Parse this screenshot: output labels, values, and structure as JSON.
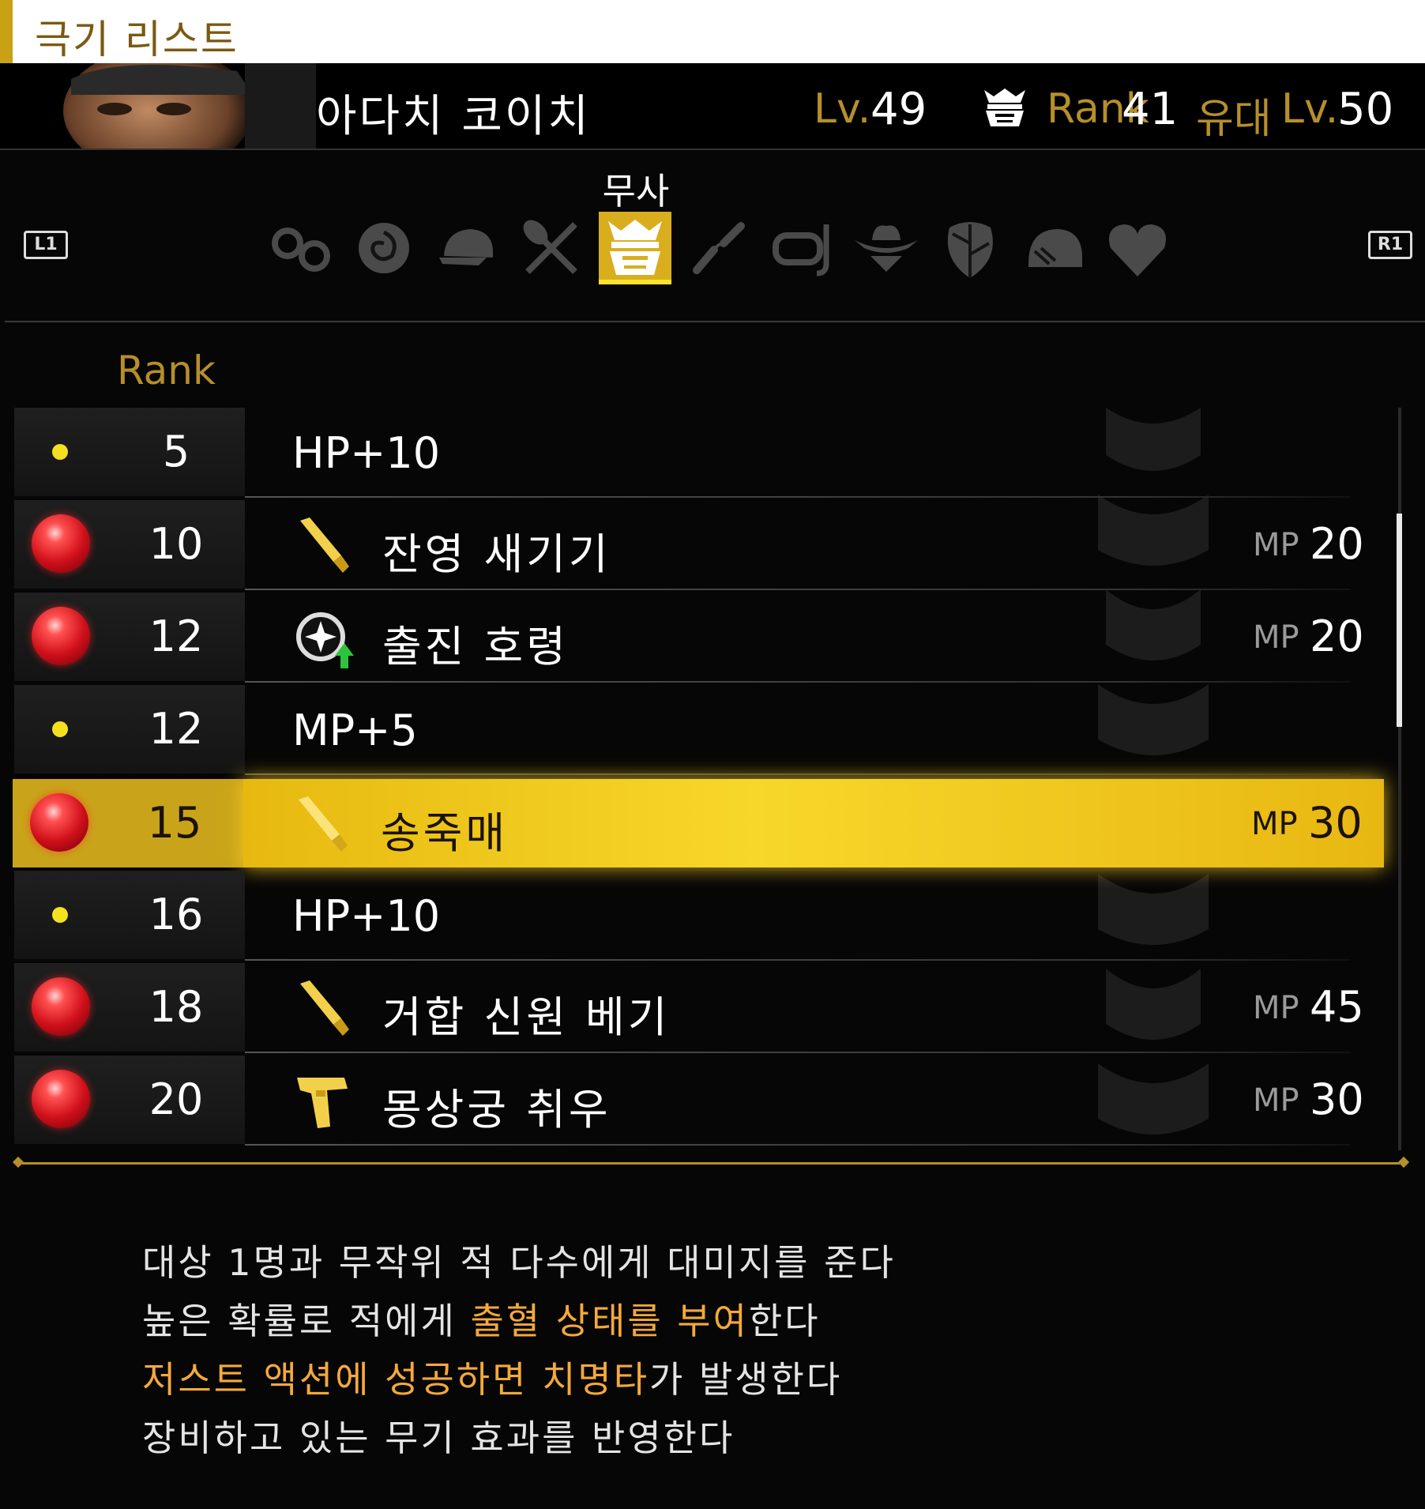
{
  "screen": {
    "title": "극기 리스트"
  },
  "character": {
    "name": "아다치 코이치",
    "lv_label": "Lv.",
    "lv_value": "49",
    "rank_label": "Rank",
    "rank_value": "41",
    "bond_label": "유대",
    "bond_lv_label": "Lv.",
    "bond_value": "50"
  },
  "jobs": {
    "prev_button": "L1",
    "next_button": "R1",
    "selected_job": "무사",
    "selected_index": 4,
    "tab_icons": [
      "handcuffs-icon",
      "rose-icon",
      "cap-icon",
      "cooking-utensils-icon",
      "samurai-helmet-icon",
      "nunchaku-icon",
      "snorkel-mask-icon",
      "cowboy-icon",
      "leaf-icon",
      "helmet-icon",
      "heart-icon"
    ]
  },
  "list": {
    "rank_header": "Rank",
    "mp_label": "MP",
    "rows": [
      {
        "type": "stat",
        "rank": "5",
        "text": "HP+10"
      },
      {
        "type": "skill",
        "rank": "10",
        "icon": "sword-icon",
        "text": "잔영 새기기",
        "mp": "20"
      },
      {
        "type": "skill",
        "rank": "12",
        "icon": "buff-shield-icon",
        "text": "출진 호령",
        "mp": "20"
      },
      {
        "type": "stat",
        "rank": "12",
        "text": "MP+5"
      },
      {
        "type": "skill",
        "rank": "15",
        "icon": "sword-icon",
        "text": "송죽매",
        "mp": "30",
        "selected": true
      },
      {
        "type": "stat",
        "rank": "16",
        "text": "HP+10"
      },
      {
        "type": "skill",
        "rank": "18",
        "icon": "sword-icon",
        "text": "거합 신원 베기",
        "mp": "45"
      },
      {
        "type": "skill",
        "rank": "20",
        "icon": "gun-icon",
        "text": "몽상궁 취우",
        "mp": "30"
      }
    ]
  },
  "description": {
    "line1": "대상 1명과 무작위 적 다수에게 대미지를 준다",
    "line2_a": "높은 확률로 적에게 ",
    "line2_b": "출혈 상태를 부여",
    "line2_c": "한다",
    "line3_a": "저스트 액션에 성공하면 치명타",
    "line3_b": "가 발생한다",
    "line4": "장비하고 있는 무기 효과를 반영한다"
  },
  "colors": {
    "accent_gold": "#b68f2a",
    "highlight": "#f7d72a",
    "orange_text": "#f5a93a"
  }
}
